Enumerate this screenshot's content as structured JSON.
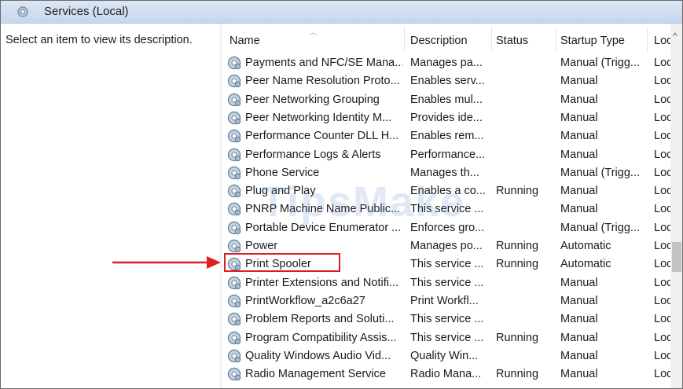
{
  "window": {
    "title": "Services (Local)",
    "icon": "gear-icon"
  },
  "left_pane": {
    "description": "Select an item to view its description."
  },
  "columns": [
    "Name",
    "Description",
    "Status",
    "Startup Type",
    "Log"
  ],
  "columns_display": {
    "log_truncated": "Loc"
  },
  "rows": [
    {
      "name": "Payments and NFC/SE Mana...",
      "description": "Manages pa...",
      "status": "",
      "startup": "Manual (Trigg...",
      "log": "Loc"
    },
    {
      "name": "Peer Name Resolution Proto...",
      "description": "Enables serv...",
      "status": "",
      "startup": "Manual",
      "log": "Loc"
    },
    {
      "name": "Peer Networking Grouping",
      "description": "Enables mul...",
      "status": "",
      "startup": "Manual",
      "log": "Loc"
    },
    {
      "name": "Peer Networking Identity M...",
      "description": "Provides ide...",
      "status": "",
      "startup": "Manual",
      "log": "Loc"
    },
    {
      "name": "Performance Counter DLL H...",
      "description": "Enables rem...",
      "status": "",
      "startup": "Manual",
      "log": "Loc"
    },
    {
      "name": "Performance Logs & Alerts",
      "description": "Performance...",
      "status": "",
      "startup": "Manual",
      "log": "Loc"
    },
    {
      "name": "Phone Service",
      "description": "Manages th...",
      "status": "",
      "startup": "Manual (Trigg...",
      "log": "Loc"
    },
    {
      "name": "Plug and Play",
      "description": "Enables a co...",
      "status": "Running",
      "startup": "Manual",
      "log": "Loc"
    },
    {
      "name": "PNRP Machine Name Public...",
      "description": "This service ...",
      "status": "",
      "startup": "Manual",
      "log": "Loc"
    },
    {
      "name": "Portable Device Enumerator ...",
      "description": "Enforces gro...",
      "status": "",
      "startup": "Manual (Trigg...",
      "log": "Loc"
    },
    {
      "name": "Power",
      "description": "Manages po...",
      "status": "Running",
      "startup": "Automatic",
      "log": "Loc"
    },
    {
      "name": "Print Spooler",
      "description": "This service ...",
      "status": "Running",
      "startup": "Automatic",
      "log": "Loc"
    },
    {
      "name": "Printer Extensions and Notifi...",
      "description": "This service ...",
      "status": "",
      "startup": "Manual",
      "log": "Loc"
    },
    {
      "name": "PrintWorkflow_a2c6a27",
      "description": "Print Workfl...",
      "status": "",
      "startup": "Manual",
      "log": "Loc"
    },
    {
      "name": "Problem Reports and Soluti...",
      "description": "This service ...",
      "status": "",
      "startup": "Manual",
      "log": "Loc"
    },
    {
      "name": "Program Compatibility Assis...",
      "description": "This service ...",
      "status": "Running",
      "startup": "Manual",
      "log": "Loc"
    },
    {
      "name": "Quality Windows Audio Vid...",
      "description": "Quality Win...",
      "status": "",
      "startup": "Manual",
      "log": "Loc"
    },
    {
      "name": "Radio Management Service",
      "description": "Radio Mana...",
      "status": "Running",
      "startup": "Manual",
      "log": "Loc"
    }
  ],
  "highlighted_row": "Print Spooler",
  "annotation": {
    "arrow_color": "#e02020",
    "box_color": "#d81e1e"
  },
  "watermark": "TipsMake"
}
